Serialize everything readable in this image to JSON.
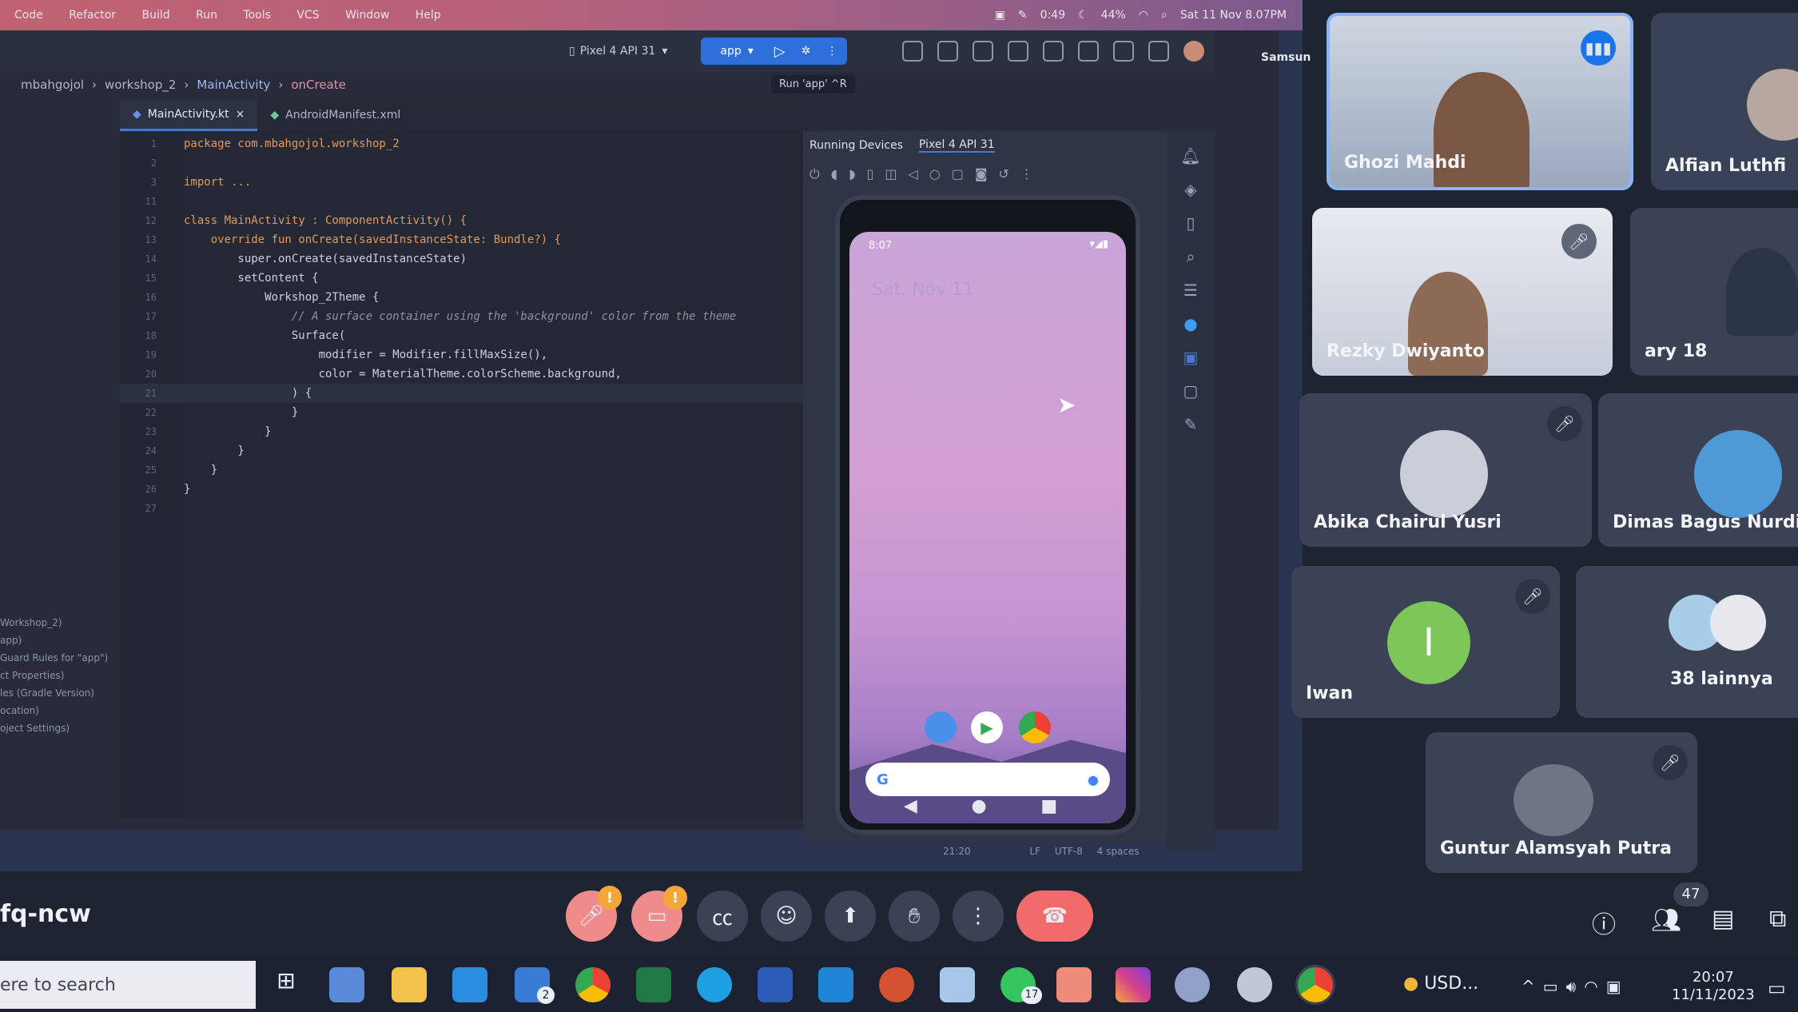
{
  "mac_menu": [
    "Code",
    "Refactor",
    "Build",
    "Run",
    "Tools",
    "VCS",
    "Window",
    "Help"
  ],
  "mac_status": {
    "battery": "44%",
    "timer": "0:49",
    "datetime": "Sat 11 Nov 8.07PM"
  },
  "toolbar": {
    "device": "Pixel 4 API 31",
    "run_config": "app",
    "run_tooltip": "Run 'app'  ^R"
  },
  "breadcrumb": [
    "mbahgojol",
    "workshop_2",
    "MainActivity",
    "onCreate"
  ],
  "editor_tabs": [
    {
      "label": "MainActivity.kt",
      "active": true
    },
    {
      "label": "AndroidManifest.xml",
      "active": false
    }
  ],
  "code_lines": [
    {
      "n": "1",
      "text": "package com.mbahgojol.workshop_2"
    },
    {
      "n": "2",
      "text": ""
    },
    {
      "n": "3",
      "text": "import ..."
    },
    {
      "n": "11",
      "text": ""
    },
    {
      "n": "12",
      "text": "class MainActivity : ComponentActivity() {"
    },
    {
      "n": "13",
      "text": "    override fun onCreate(savedInstanceState: Bundle?) {"
    },
    {
      "n": "14",
      "text": "        super.onCreate(savedInstanceState)"
    },
    {
      "n": "15",
      "text": "        setContent {"
    },
    {
      "n": "16",
      "text": "            Workshop_2Theme {"
    },
    {
      "n": "17",
      "text": "                // A surface container using the 'background' color from the theme"
    },
    {
      "n": "18",
      "text": "                Surface("
    },
    {
      "n": "19",
      "text": "                    modifier = Modifier.fillMaxSize(),"
    },
    {
      "n": "20",
      "text": "                    color = MaterialTheme.colorScheme.background,"
    },
    {
      "n": "21",
      "text": "                ) {"
    },
    {
      "n": "22",
      "text": "                }"
    },
    {
      "n": "23",
      "text": "            }"
    },
    {
      "n": "24",
      "text": "        }"
    },
    {
      "n": "25",
      "text": "    }"
    },
    {
      "n": "26",
      "text": "}"
    },
    {
      "n": "27",
      "text": ""
    }
  ],
  "project_tree": [
    "Workshop_2)",
    "app)",
    "Guard Rules for \"app\")",
    "ct Properties)",
    "les (Gradle Version)",
    "ocation)",
    "oject Settings)"
  ],
  "device_panel": {
    "tab_running": "Running Devices",
    "tab_device": "Pixel 4 API 31",
    "phone_time": "8:07",
    "phone_date": "Sat, Nov 11"
  },
  "ide_status": {
    "pos": "21:20",
    "line_sep": "LF",
    "encoding": "UTF-8",
    "indent": "4 spaces"
  },
  "participants": [
    {
      "name": "Ghozi Mahdi",
      "speaking": true
    },
    {
      "name": "Alfian Luthfi"
    },
    {
      "name": "Rezky Dwiyanto",
      "muted": true
    },
    {
      "name": "ary 18"
    },
    {
      "name": "Abika Chairul Yusri",
      "muted": true
    },
    {
      "name": "Dimas Bagus Nurdia"
    },
    {
      "name": "Iwan",
      "initial": "I",
      "muted": true
    },
    {
      "name": "38 lainnya"
    },
    {
      "name": "Guntur Alamsyah Putra",
      "muted": true
    }
  ],
  "meeting_code": "fq-ncw",
  "people_count": "47",
  "presenter_label": "Samsun",
  "taskbar": {
    "search_placeholder": "ere to search",
    "currency": "USD...",
    "time": "20:07",
    "date": "11/11/2023",
    "whatsapp_badge": "17",
    "mail_badge": "2"
  },
  "colors": {
    "accent_blue": "#2f6fdc",
    "end_call": "#f26b6b",
    "iwan_avatar": "#7cc65a"
  }
}
